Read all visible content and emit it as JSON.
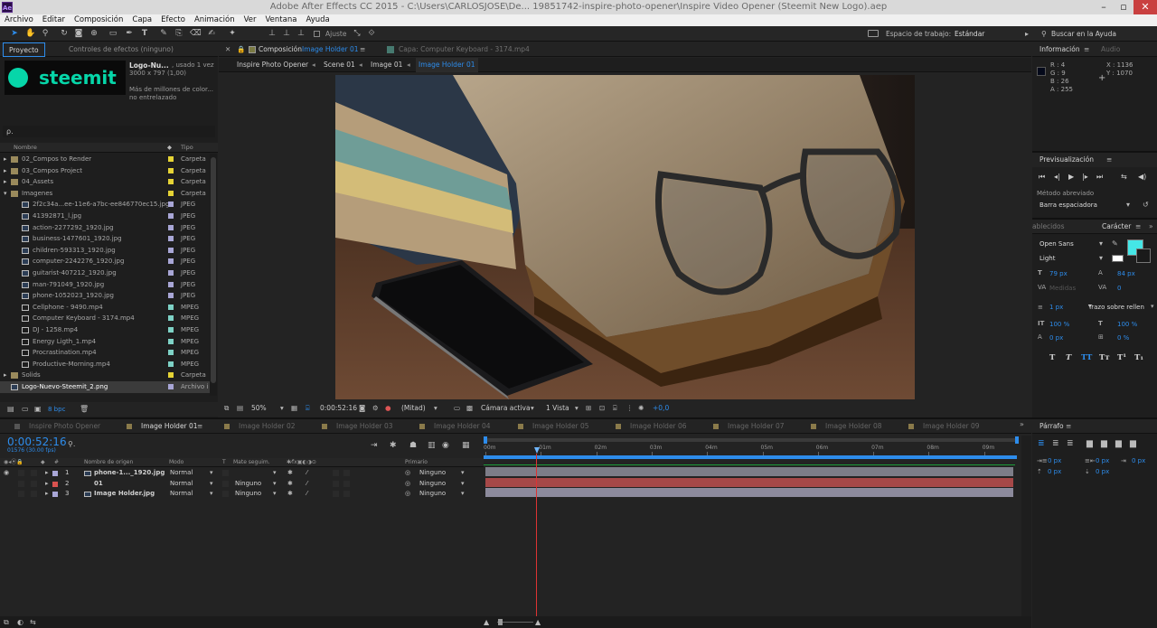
{
  "window": {
    "title": "Adobe After Effects CC 2015 - C:\\Users\\CARLOSJOSE\\De... 19851742-inspire-photo-opener\\Inspire Video Opener (Steemit New Logo).aep",
    "app_badge": "Ae"
  },
  "menu": [
    "Archivo",
    "Editar",
    "Composición",
    "Capa",
    "Efecto",
    "Animación",
    "Ver",
    "Ventana",
    "Ayuda"
  ],
  "toolbar": {
    "snap_label": "Ajuste",
    "workspace_label": "Espacio de trabajo:",
    "workspace_value": "Estándar",
    "help_placeholder": "Buscar en la Ayuda"
  },
  "project": {
    "tab": "Proyecto",
    "tab2": "Controles de efectos (ninguno)",
    "preview": {
      "name": "Logo-Nu...",
      "used": ", usado 1 vez",
      "dims": "3000 x 797 (1,00)",
      "desc1": "Más de millones de color...",
      "desc2": "no entrelazado",
      "logo_text": "steemit"
    },
    "search_icon_label": "ρ.",
    "col_name": "Nombre",
    "col_type": "Tipo",
    "items": [
      {
        "name": "02_Compos to Render",
        "type": "Carpeta",
        "color": "#e5d335",
        "kind": "folder",
        "indent": 0
      },
      {
        "name": "03_Compos Project",
        "type": "Carpeta",
        "color": "#e5d335",
        "kind": "folder",
        "indent": 0
      },
      {
        "name": "04_Assets",
        "type": "Carpeta",
        "color": "#e5d335",
        "kind": "folder",
        "indent": 0
      },
      {
        "name": "Imagenes",
        "type": "Carpeta",
        "color": "#e5d335",
        "kind": "folder-open",
        "indent": 0
      },
      {
        "name": "2f2c34a...ee-11e6-a7bc-ee846770ec15.jpg",
        "type": "JPEG",
        "color": "#a8a6d6",
        "kind": "file",
        "indent": 1
      },
      {
        "name": "41392871_l.jpg",
        "type": "JPEG",
        "color": "#a8a6d6",
        "kind": "file",
        "indent": 1
      },
      {
        "name": "action-2277292_1920.jpg",
        "type": "JPEG",
        "color": "#a8a6d6",
        "kind": "file",
        "indent": 1
      },
      {
        "name": "business-1477601_1920.jpg",
        "type": "JPEG",
        "color": "#a8a6d6",
        "kind": "file",
        "indent": 1
      },
      {
        "name": "children-593313_1920.jpg",
        "type": "JPEG",
        "color": "#a8a6d6",
        "kind": "file",
        "indent": 1
      },
      {
        "name": "computer-2242276_1920.jpg",
        "type": "JPEG",
        "color": "#a8a6d6",
        "kind": "file",
        "indent": 1
      },
      {
        "name": "guitarist-407212_1920.jpg",
        "type": "JPEG",
        "color": "#a8a6d6",
        "kind": "file",
        "indent": 1
      },
      {
        "name": "man-791049_1920.jpg",
        "type": "JPEG",
        "color": "#a8a6d6",
        "kind": "file",
        "indent": 1
      },
      {
        "name": "phone-1052023_1920.jpg",
        "type": "JPEG",
        "color": "#a8a6d6",
        "kind": "file",
        "indent": 1
      },
      {
        "name": "Cellphone - 9490.mp4",
        "type": "MPEG",
        "color": "#7ed2c6",
        "kind": "video",
        "indent": 1
      },
      {
        "name": "Computer Keyboard - 3174.mp4",
        "type": "MPEG",
        "color": "#7ed2c6",
        "kind": "video",
        "indent": 1
      },
      {
        "name": "DJ - 1258.mp4",
        "type": "MPEG",
        "color": "#7ed2c6",
        "kind": "video",
        "indent": 1
      },
      {
        "name": "Energy Ligth_1.mp4",
        "type": "MPEG",
        "color": "#7ed2c6",
        "kind": "video",
        "indent": 1
      },
      {
        "name": "Procrastination.mp4",
        "type": "MPEG",
        "color": "#7ed2c6",
        "kind": "video",
        "indent": 1
      },
      {
        "name": "Productive-Morning.mp4",
        "type": "MPEG",
        "color": "#7ed2c6",
        "kind": "video",
        "indent": 1
      },
      {
        "name": "Solids",
        "type": "Carpeta",
        "color": "#e5d335",
        "kind": "folder",
        "indent": 0
      },
      {
        "name": "Logo-Nuevo-Steemit_2.png",
        "type": "Archivo i",
        "color": "#a8a6d6",
        "kind": "file",
        "indent": 0,
        "selected": true
      }
    ],
    "bpc": "8 bpc"
  },
  "composition": {
    "tab": "Composición",
    "tab_name": "Image Holder 01",
    "layer_tab": "Capa: Computer Keyboard - 3174.mp4",
    "breadcrumbs": [
      "Inspire Photo Opener",
      "Scene 01",
      "Image 01",
      "Image Holder 01"
    ],
    "zoom": "50%",
    "timecode": "0:00:52:16",
    "resolution": "(Mitad)",
    "camera": "Cámara activa",
    "views": "1 Vista",
    "exposure": "+0,0"
  },
  "info": {
    "tab": "Información",
    "tab2": "Audio",
    "r": "R :",
    "r_val": "4",
    "g": "G :",
    "g_val": "9",
    "b": "B :",
    "b_val": "26",
    "a": "A :",
    "a_val": "255",
    "x": "X :",
    "x_val": "1136",
    "y": "Y :",
    "y_val": "1070"
  },
  "preview": {
    "title": "Previsualización",
    "shortcut_label": "Método abreviado",
    "shortcut_value": "Barra espaciadora"
  },
  "character": {
    "tab1": "ablecidos",
    "tab2": "Carácter",
    "font": "Open Sans",
    "style": "Light",
    "size": "79 px",
    "leading": "84 px",
    "kerning": "Medidas",
    "tracking": "0",
    "stroke": "1 px",
    "stroke_mode": "Trazo sobre rellen",
    "v_scale": "100 %",
    "h_scale": "100 %",
    "baseline": "0 px",
    "tsume": "0 %",
    "fill_color": "#45e6e6"
  },
  "paragraph": {
    "title": "Párrafo",
    "v1": "0 px",
    "v2": "0 px",
    "v3": "0 px",
    "v4": "0 px",
    "v5": "0 px"
  },
  "timeline": {
    "tabs": [
      "Inspire Photo Opener",
      "Image Holder 01",
      "Image Holder 02",
      "Image Holder 03",
      "Image Holder 04",
      "Image Holder 05",
      "Image Holder 06",
      "Image Holder 07",
      "Image Holder 08",
      "Image Holder 09"
    ],
    "active_tab": 1,
    "timecode": "0:00:52:16",
    "frames": "01576 (30.00 fps)",
    "cols": {
      "num": "#",
      "source": "Nombre de origen",
      "mode": "Modo",
      "t": "T",
      "matte": "Mate seguim.",
      "parent": "Primario"
    },
    "ruler": [
      "00m",
      "01m",
      "02m",
      "03m",
      "04m",
      "05m",
      "06m",
      "07m",
      "08m",
      "09m"
    ],
    "layers": [
      {
        "num": "1",
        "name": "phone-1..._1920.jpg",
        "mode": "Normal",
        "matte": "",
        "parent": "Ninguno",
        "color": "#a8a6d6",
        "bar": "#7d7d88"
      },
      {
        "num": "2",
        "name": "01",
        "mode": "Normal",
        "matte": "Ninguno",
        "parent": "Ninguno",
        "color": "#d8524f",
        "bar": "#a64848"
      },
      {
        "num": "3",
        "name": "Image Holder.jpg",
        "mode": "Normal",
        "matte": "Ninguno",
        "parent": "Ninguno",
        "color": "#a8a6d6",
        "bar": "#8c8a9c"
      }
    ]
  }
}
